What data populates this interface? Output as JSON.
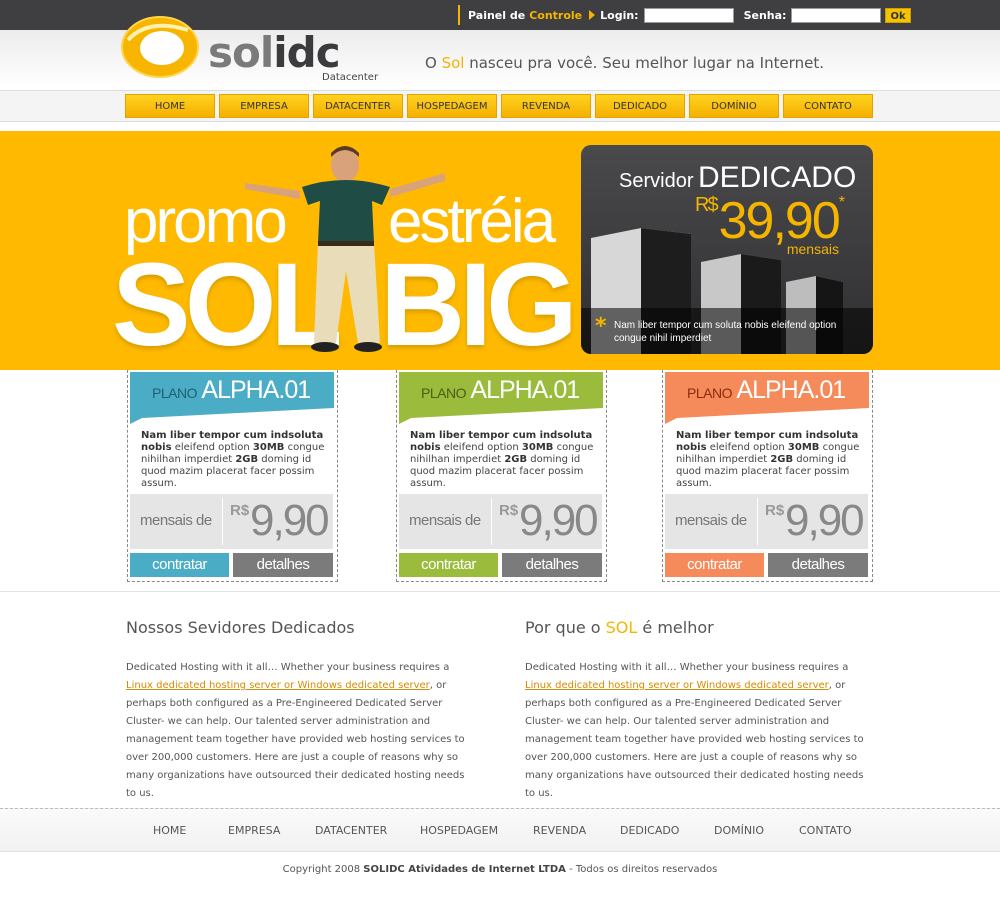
{
  "topbar": {
    "painel_label": "Painel de",
    "controle_label": "Controle",
    "login_label": "Login:",
    "login_value": "",
    "senha_label": "Senha:",
    "senha_value": "",
    "ok_label": "Ok"
  },
  "header": {
    "logo_part1": "sol",
    "logo_part2": "idc",
    "logo_sub": "Datacenter",
    "slogan_pre": "O ",
    "slogan_sol": "Sol",
    "slogan_post": " nasceu pra você. Seu melhor lugar na Internet."
  },
  "nav": [
    "HOME",
    "EMPRESA",
    "DATACENTER",
    "HOSPEDAGEM",
    "REVENDA",
    "DEDICADO",
    "DOMÍNIO",
    "CONTATO"
  ],
  "banner": {
    "promo": "promo",
    "estreia": "estréia",
    "sol": "SOL",
    "big": "BIG",
    "box_title_1": "Servidor",
    "box_title_2": "DEDICADO",
    "box_currency": "R$",
    "box_price": "39,90",
    "box_asterisk": "*",
    "box_period": "mensais",
    "box_note_star": "*",
    "box_note": "Nam liber tempor cum soluta nobis eleifend option congue nihil imperdiet"
  },
  "plans": [
    {
      "plano_label": "PLANO",
      "name": "ALPHA.01",
      "color": "#4bacc6",
      "plano_color": "#1f5f73",
      "desc_1": "Nam liber tempor cum indsoluta",
      "desc_2": "nobis",
      "desc_3": " eleifend option ",
      "desc_4": "30MB",
      "desc_5": " congue nihilhan imperdiet ",
      "desc_6": "2GB",
      "desc_7": " doming id quod mazim placerat facer possim assum.",
      "mensais": "mensais de",
      "currency": "R$",
      "price": "9,90",
      "contratar": "contratar",
      "detalhes": "detalhes"
    },
    {
      "plano_label": "PLANO",
      "name": "ALPHA.01",
      "color": "#9bbb3c",
      "plano_color": "#4b5e15",
      "desc_1": "Nam liber tempor cum indsoluta",
      "desc_2": "nobis",
      "desc_3": " eleifend option ",
      "desc_4": "30MB",
      "desc_5": " congue nihilhan imperdiet ",
      "desc_6": "2GB",
      "desc_7": " doming id quod mazim placerat facer possim assum.",
      "mensais": "mensais de",
      "currency": "R$",
      "price": "9,90",
      "contratar": "contratar",
      "detalhes": "detalhes"
    },
    {
      "plano_label": "PLANO",
      "name": "ALPHA.01",
      "color": "#f58a5b",
      "plano_color": "#8a2d0b",
      "desc_1": "Nam liber tempor cum indsoluta",
      "desc_2": "nobis",
      "desc_3": " eleifend option ",
      "desc_4": "30MB",
      "desc_5": " congue nihilhan imperdiet ",
      "desc_6": "2GB",
      "desc_7": " doming id quod mazim placerat facer possim assum.",
      "mensais": "mensais de",
      "currency": "R$",
      "price": "9,90",
      "contratar": "contratar",
      "detalhes": "detalhes"
    }
  ],
  "content": {
    "left_title": "Nossos Sevidores Dedicados",
    "right_title_pre": "Por que o ",
    "right_title_sol": "SOL",
    "right_title_post": " é melhor",
    "text_pre": "Dedicated Hosting with it all… Whether your business requires a ",
    "text_link": "Linux dedicated hosting server or Windows dedicated server",
    "text_post": ", or perhaps both configured as a Pre-Engineered Dedicated Server Cluster- we can help. Our talented server administration and management team together have provided web hosting services to over 200,000 customers. Here are just a couple of reasons why so many organizations have outsourced their dedicated hosting needs to us."
  },
  "footer": {
    "nav": [
      "HOME",
      "EMPRESA",
      "DATACENTER",
      "HOSPEDAGEM",
      "REVENDA",
      "DEDICADO",
      "DOMÍNIO",
      "CONTATO"
    ],
    "copy_pre": "Copyright 2008 ",
    "copy_company": "SOLIDC Atividades de Internet LTDA",
    "copy_post": " - Todos os direitos reservados"
  },
  "colors": {
    "accent": "#f5b400",
    "banner": "#feb900",
    "dark": "#3f3f42"
  }
}
